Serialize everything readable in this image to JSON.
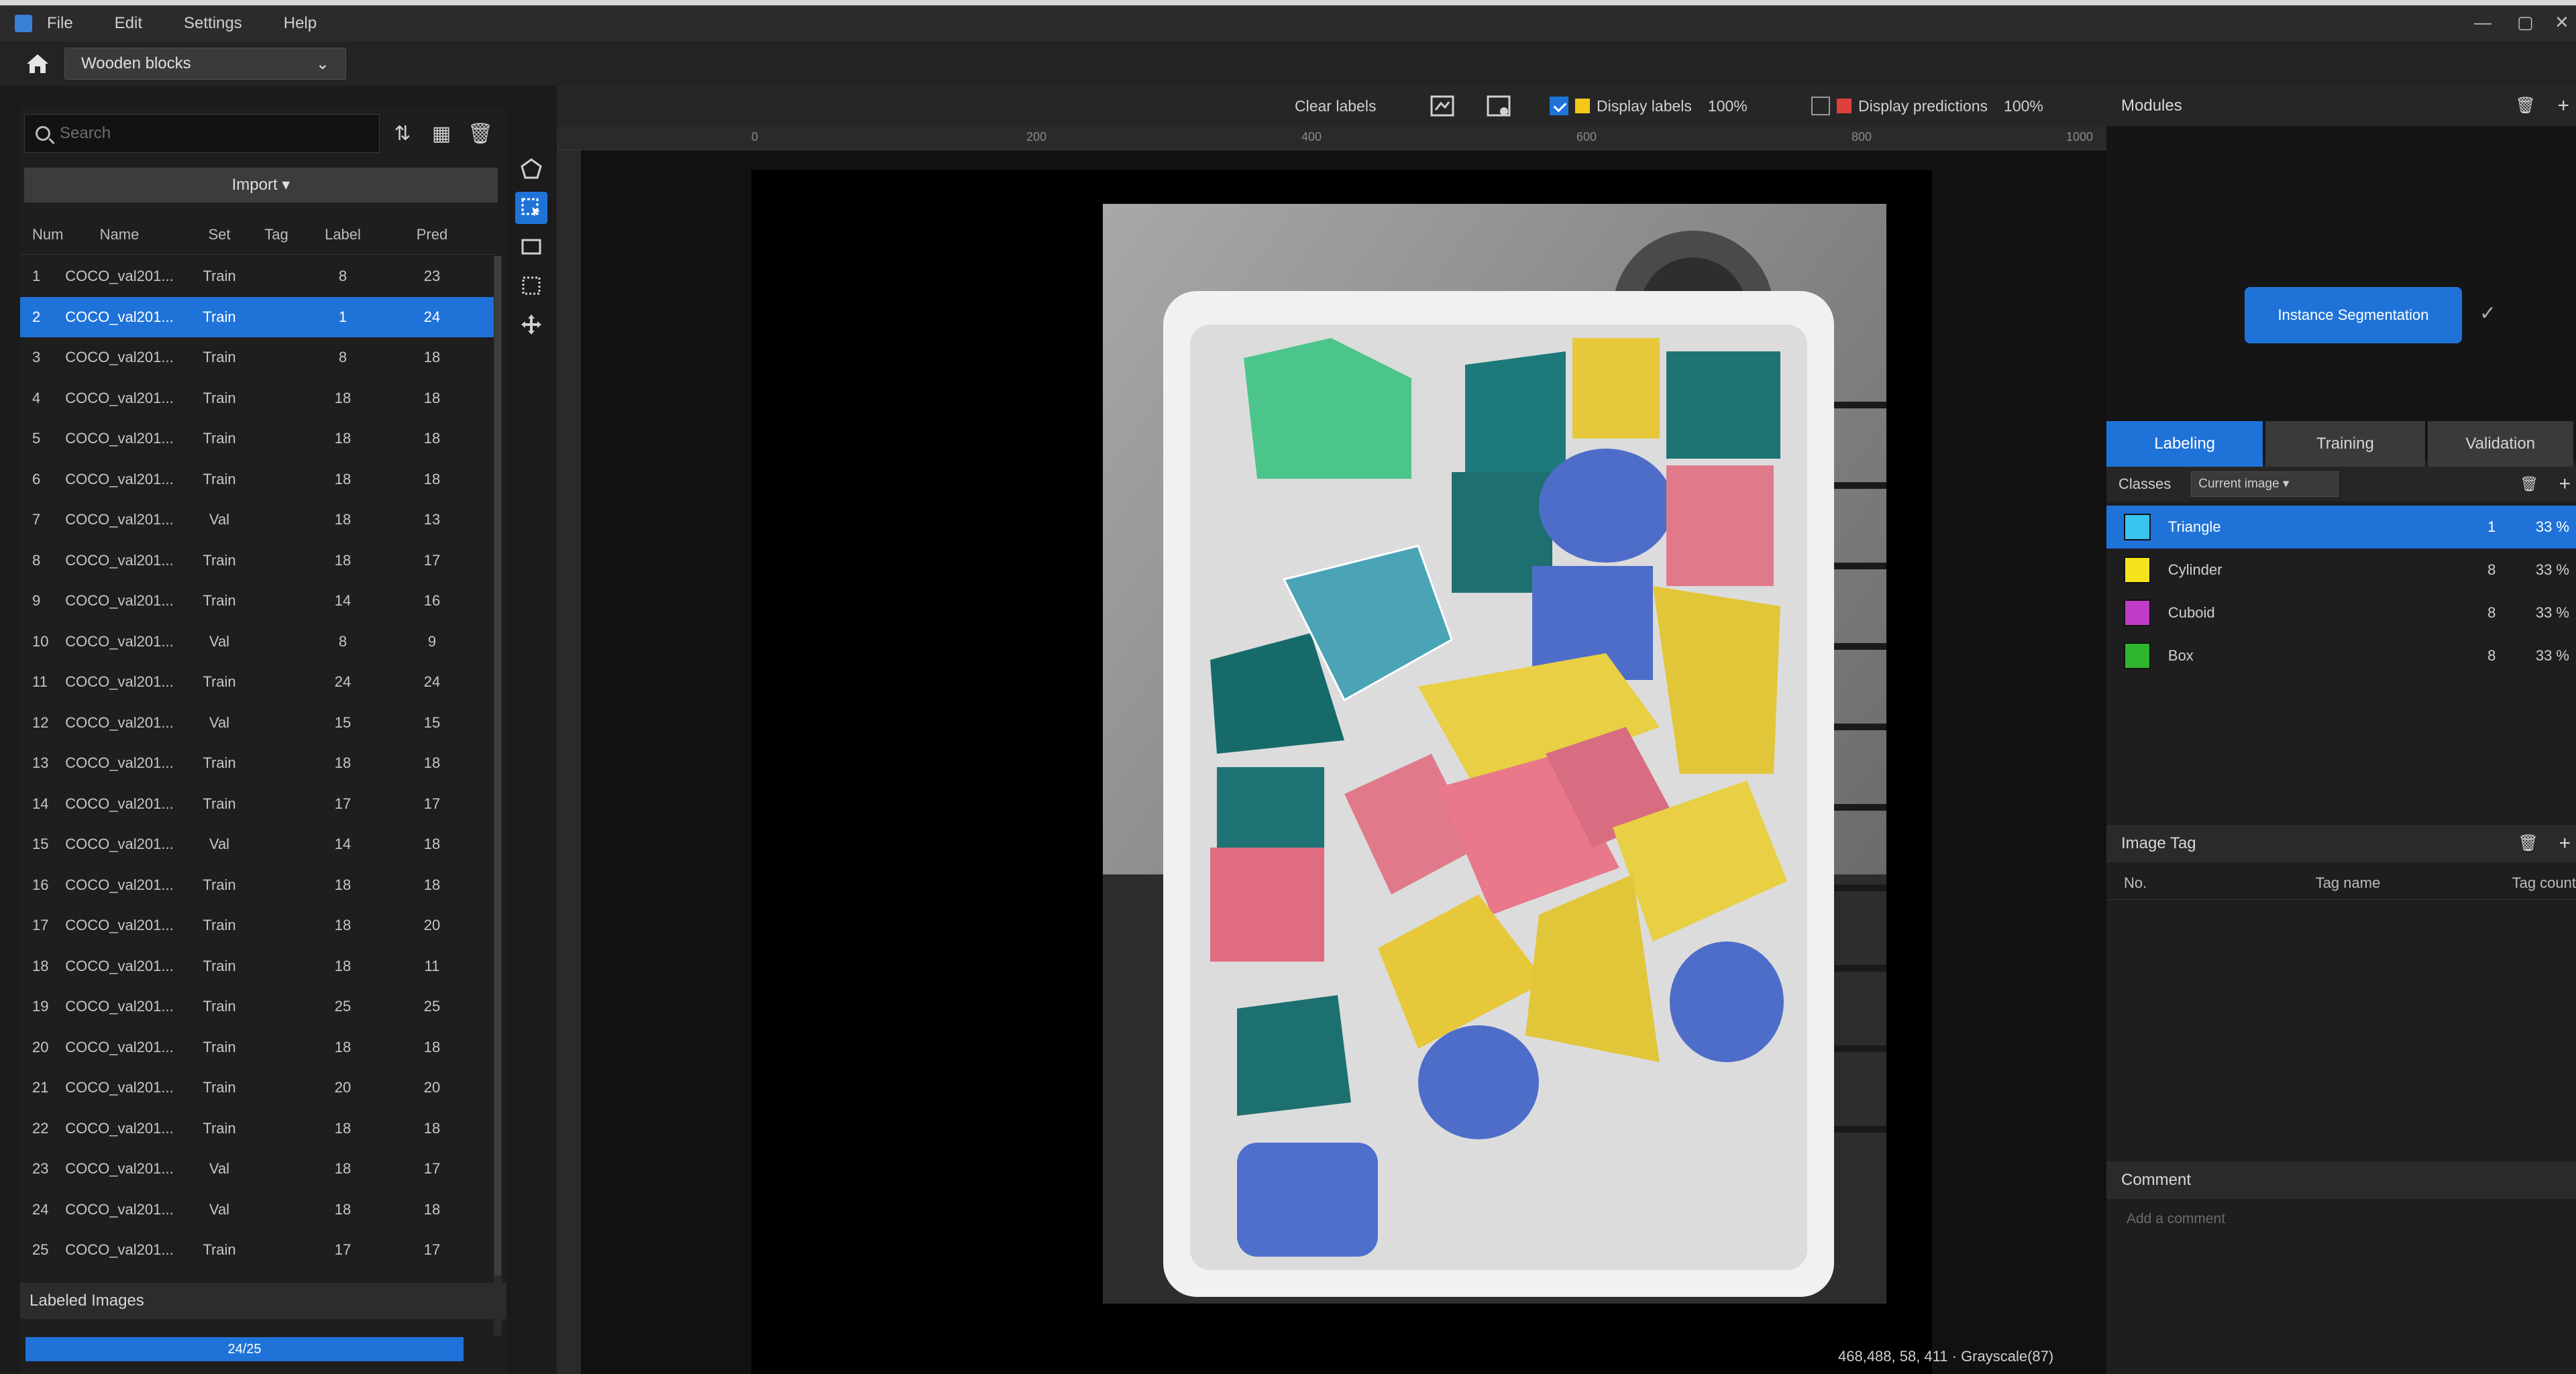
{
  "menu": [
    "File",
    "Edit",
    "Settings",
    "Help"
  ],
  "project": {
    "name": "Wooden blocks"
  },
  "search": {
    "placeholder": "Search"
  },
  "import_label": "Import",
  "image_table": {
    "headers": [
      "Num",
      "Name",
      "Set",
      "Tag",
      "Label",
      "Pred"
    ],
    "rows": [
      [
        "1",
        "COCO_val201...",
        "Train",
        "",
        "8",
        "23"
      ],
      [
        "2",
        "COCO_val201...",
        "Train",
        "",
        "1",
        "24"
      ],
      [
        "3",
        "COCO_val201...",
        "Train",
        "",
        "8",
        "18"
      ],
      [
        "4",
        "COCO_val201...",
        "Train",
        "",
        "18",
        "18"
      ],
      [
        "5",
        "COCO_val201...",
        "Train",
        "",
        "18",
        "18"
      ],
      [
        "6",
        "COCO_val201...",
        "Train",
        "",
        "18",
        "18"
      ],
      [
        "7",
        "COCO_val201...",
        "Val",
        "",
        "18",
        "13"
      ],
      [
        "8",
        "COCO_val201...",
        "Train",
        "",
        "18",
        "17"
      ],
      [
        "9",
        "COCO_val201...",
        "Train",
        "",
        "14",
        "16"
      ],
      [
        "10",
        "COCO_val201...",
        "Val",
        "",
        "8",
        "9"
      ],
      [
        "11",
        "COCO_val201...",
        "Train",
        "",
        "24",
        "24"
      ],
      [
        "12",
        "COCO_val201...",
        "Val",
        "",
        "15",
        "15"
      ],
      [
        "13",
        "COCO_val201...",
        "Train",
        "",
        "18",
        "18"
      ],
      [
        "14",
        "COCO_val201...",
        "Train",
        "",
        "17",
        "17"
      ],
      [
        "15",
        "COCO_val201...",
        "Val",
        "",
        "14",
        "18"
      ],
      [
        "16",
        "COCO_val201...",
        "Train",
        "",
        "18",
        "18"
      ],
      [
        "17",
        "COCO_val201...",
        "Train",
        "",
        "18",
        "20"
      ],
      [
        "18",
        "COCO_val201...",
        "Train",
        "",
        "18",
        "11"
      ],
      [
        "19",
        "COCO_val201...",
        "Train",
        "",
        "25",
        "25"
      ],
      [
        "20",
        "COCO_val201...",
        "Train",
        "",
        "18",
        "18"
      ],
      [
        "21",
        "COCO_val201...",
        "Train",
        "",
        "20",
        "20"
      ],
      [
        "22",
        "COCO_val201...",
        "Train",
        "",
        "18",
        "18"
      ],
      [
        "23",
        "COCO_val201...",
        "Val",
        "",
        "18",
        "17"
      ],
      [
        "24",
        "COCO_val201...",
        "Val",
        "",
        "18",
        "18"
      ],
      [
        "25",
        "COCO_val201...",
        "Train",
        "",
        "17",
        "17"
      ]
    ],
    "selected_index": 1
  },
  "labeled_images_label": "Labeled Images",
  "labeled_progress": {
    "text": "24/25",
    "fraction": 0.96
  },
  "canvas_toolbar": {
    "clear_labels": "Clear labels",
    "display_labels": "Display labels",
    "display_labels_pct": "100%",
    "display_predictions": "Display predictions",
    "display_predictions_pct": "100%"
  },
  "ruler_ticks": [
    "0",
    "200",
    "400",
    "600",
    "800",
    "1000"
  ],
  "status_text": "468,488, 58, 411 · Grayscale(87)",
  "modules": {
    "title": "Modules",
    "node_label": "Instance Segmentation"
  },
  "tabs": [
    "Labeling",
    "Training",
    "Validation"
  ],
  "classes": {
    "title": "Classes",
    "filter": "Current image",
    "items": [
      {
        "name": "Triangle",
        "count": "1",
        "pct": "33 %",
        "color": "#39c3ef"
      },
      {
        "name": "Cylinder",
        "count": "8",
        "pct": "33 %",
        "color": "#f4e31b"
      },
      {
        "name": "Cuboid",
        "count": "8",
        "pct": "33 %",
        "color": "#c03cc8"
      },
      {
        "name": "Box",
        "count": "8",
        "pct": "33 %",
        "color": "#2fb52c"
      }
    ]
  },
  "image_tag": {
    "title": "Image Tag",
    "headers": [
      "No.",
      "Tag name",
      "Tag count"
    ]
  },
  "comment": {
    "title": "Comment",
    "placeholder": "Add a comment"
  },
  "colors": {
    "accent": "#1f73d8",
    "panel": "#1e1e1e",
    "toolbar": "#262626"
  }
}
